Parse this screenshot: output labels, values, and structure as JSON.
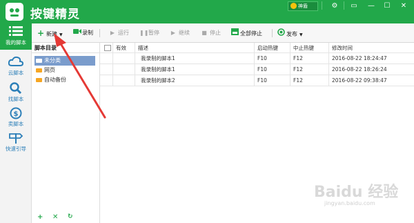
{
  "app": {
    "title": "按键精灵"
  },
  "titlebar": {
    "user_label": "神盾",
    "settings_icon": "gear-icon",
    "minimize_icon": "minimize-icon",
    "maximize_icon": "maximize-icon",
    "close_icon": "close-icon"
  },
  "nav": {
    "items": [
      {
        "label": "我的脚本",
        "icon": "list-icon",
        "active": true
      },
      {
        "label": "云脚本",
        "icon": "cloud-icon"
      },
      {
        "label": "找脚本",
        "icon": "search-icon"
      },
      {
        "label": "卖脚本",
        "icon": "dollar-icon"
      },
      {
        "label": "快速引导",
        "icon": "signpost-icon"
      }
    ]
  },
  "toolbar": {
    "new": "新建",
    "record": "录制",
    "run": "运行",
    "pause": "暂停",
    "resume": "继续",
    "stop": "停止",
    "stop_all": "全部停止",
    "publish": "发布"
  },
  "directory": {
    "header": "脚本目录",
    "items": [
      "未分类",
      "网页",
      "自动备份"
    ]
  },
  "table": {
    "columns": [
      "有效",
      "描述",
      "启动热键",
      "中止热键",
      "修改时间"
    ],
    "rows": [
      {
        "checked": false,
        "desc": "我录制的脚本1",
        "start": "F10",
        "stop": "F12",
        "time": "2016-08-22 18:24:47"
      },
      {
        "checked": true,
        "desc": "我录制的脚本1",
        "start": "F10",
        "stop": "F12",
        "time": "2016-08-22 18:26:24"
      },
      {
        "checked": false,
        "desc": "我录制的脚本2",
        "start": "F10",
        "stop": "F12",
        "time": "2016-08-22 09:38:47"
      }
    ]
  },
  "watermark": {
    "brand": "Baidu 经验",
    "url": "jingyan.baidu.com"
  },
  "colors": {
    "primary": "#22a84a",
    "selection": "#7a9ccc",
    "arrow": "#e53935"
  }
}
